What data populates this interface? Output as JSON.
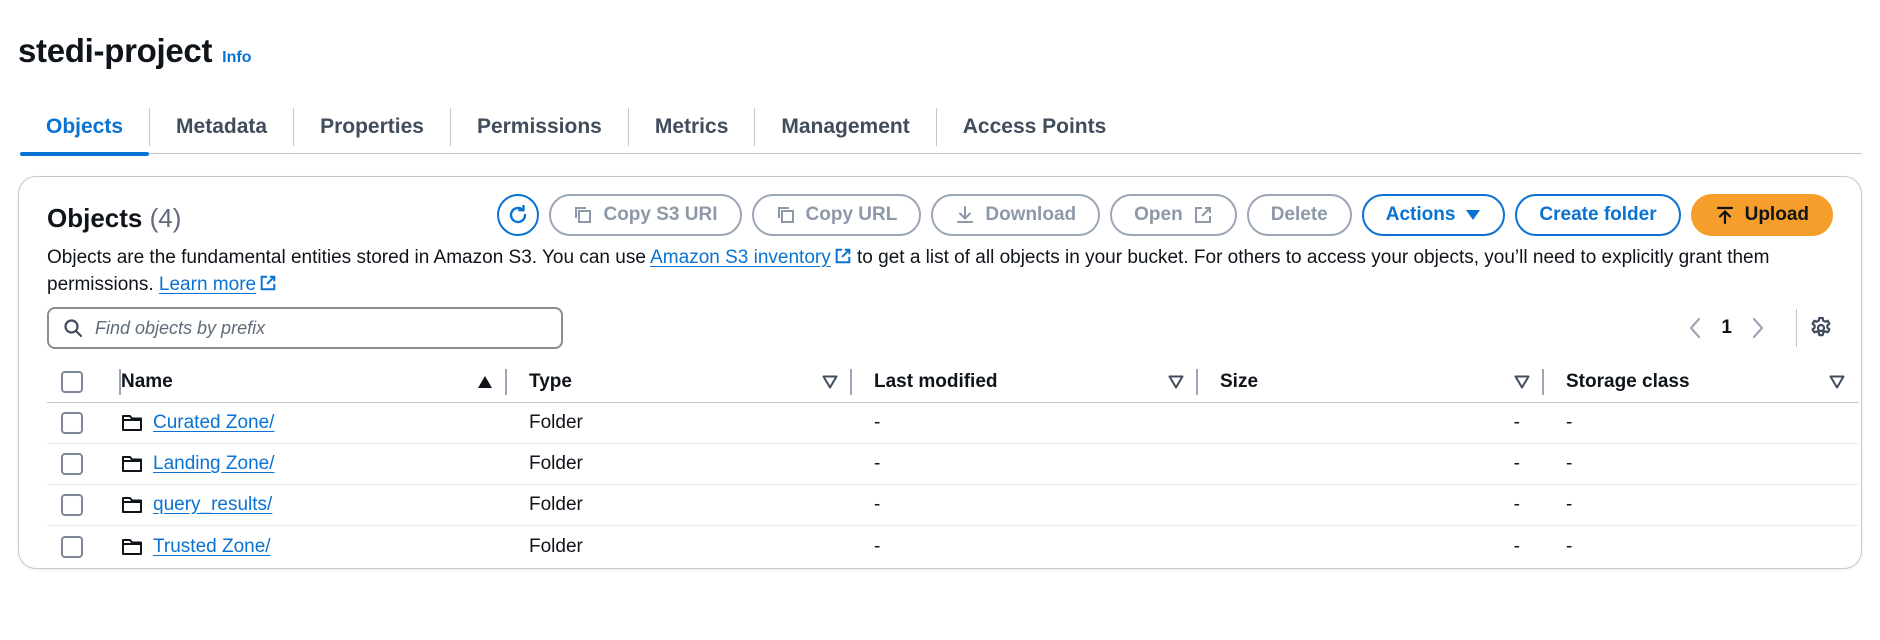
{
  "header": {
    "title": "stedi-project",
    "info": "Info"
  },
  "tabs": [
    {
      "label": "Objects",
      "active": true
    },
    {
      "label": "Metadata"
    },
    {
      "label": "Properties"
    },
    {
      "label": "Permissions"
    },
    {
      "label": "Metrics"
    },
    {
      "label": "Management"
    },
    {
      "label": "Access Points"
    }
  ],
  "objects": {
    "title": "Objects",
    "count": "(4)",
    "toolbar": {
      "copy_s3_uri": "Copy S3 URI",
      "copy_url": "Copy URL",
      "download": "Download",
      "open": "Open",
      "delete": "Delete",
      "actions": "Actions",
      "create_folder": "Create folder",
      "upload": "Upload"
    },
    "description": {
      "part1": "Objects are the fundamental entities stored in Amazon S3. You can use ",
      "link1": "Amazon S3 inventory",
      "part2": " to get a list of all objects in your bucket. For others to access your objects, you’ll need to explicitly grant them permissions. ",
      "link2": "Learn more"
    },
    "search": {
      "placeholder": "Find objects by prefix",
      "value": ""
    },
    "pagination": {
      "page": "1"
    },
    "table": {
      "columns": [
        "Name",
        "Type",
        "Last modified",
        "Size",
        "Storage class"
      ],
      "rows": [
        {
          "name": "Curated Zone/",
          "type": "Folder",
          "last_modified": "-",
          "size": "-",
          "storage_class": "-"
        },
        {
          "name": "Landing Zone/",
          "type": "Folder",
          "last_modified": "-",
          "size": "-",
          "storage_class": "-"
        },
        {
          "name": "query_results/",
          "type": "Folder",
          "last_modified": "-",
          "size": "-",
          "storage_class": "-"
        },
        {
          "name": "Trusted Zone/",
          "type": "Folder",
          "last_modified": "-",
          "size": "-",
          "storage_class": "-"
        }
      ]
    }
  },
  "colors": {
    "link": "#0972d3",
    "upload": "#f59e2b",
    "text": "#0f141a",
    "disabled": "#8d99a8"
  }
}
